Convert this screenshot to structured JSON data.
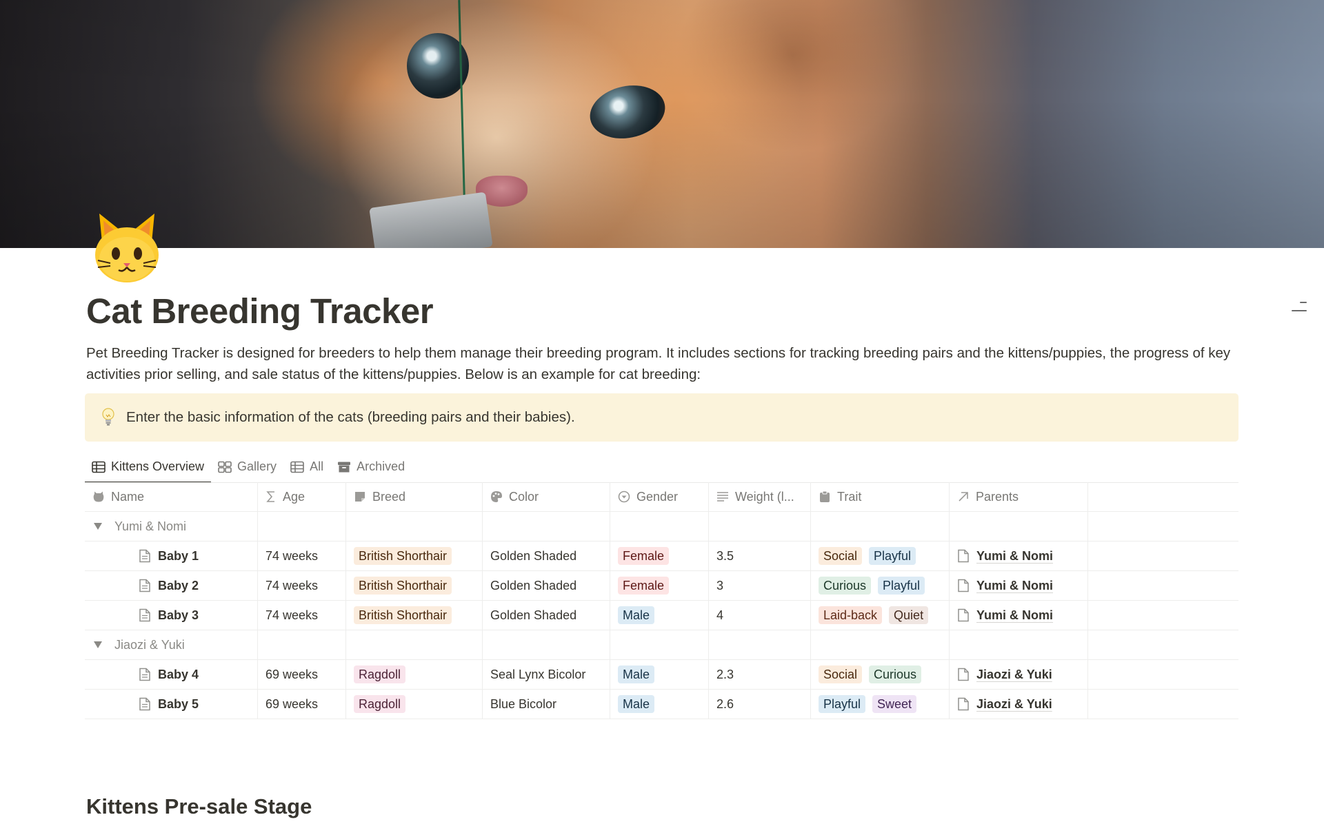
{
  "page": {
    "title": "Cat Breeding Tracker",
    "description": "Pet Breeding Tracker is designed for breeders to help them manage their breeding program. It includes sections for tracking breeding pairs and the kittens/puppies, the progress of key activities prior selling, and sale status of the kittens/puppies. Below is an example for cat breeding:",
    "icon": "cat-face-icon",
    "cover": "kitten-photo"
  },
  "callout": {
    "icon": "light-bulb-icon",
    "text": "Enter the basic information of the cats (breeding pairs and their babies)."
  },
  "tabs": [
    {
      "label": "Kittens Overview",
      "icon": "table-icon",
      "active": true
    },
    {
      "label": "Gallery",
      "icon": "gallery-icon",
      "active": false
    },
    {
      "label": "All",
      "icon": "table-icon",
      "active": false
    },
    {
      "label": "Archived",
      "icon": "archive-icon",
      "active": false
    }
  ],
  "table": {
    "columns": [
      {
        "label": "Name",
        "icon": "pet-icon"
      },
      {
        "label": "Age",
        "icon": "formula-icon"
      },
      {
        "label": "Breed",
        "icon": "select-icon"
      },
      {
        "label": "Color",
        "icon": "palette-icon"
      },
      {
        "label": "Gender",
        "icon": "status-icon"
      },
      {
        "label": "Weight (l...",
        "icon": "text-lines-icon"
      },
      {
        "label": "Trait",
        "icon": "clipboard-icon"
      },
      {
        "label": "Parents",
        "icon": "relation-arrow-icon"
      }
    ],
    "groups": [
      {
        "label": "Yumi & Nomi",
        "rows": [
          {
            "name": "Baby 1",
            "age": "74 weeks",
            "breed": "British Shorthair",
            "color": "Golden Shaded",
            "gender": "Female",
            "weight": "3.5",
            "traits": [
              "Social",
              "Playful"
            ],
            "parents": "Yumi & Nomi"
          },
          {
            "name": "Baby 2",
            "age": "74 weeks",
            "breed": "British Shorthair",
            "color": "Golden Shaded",
            "gender": "Female",
            "weight": "3",
            "traits": [
              "Curious",
              "Playful"
            ],
            "parents": "Yumi & Nomi"
          },
          {
            "name": "Baby 3",
            "age": "74 weeks",
            "breed": "British Shorthair",
            "color": "Golden Shaded",
            "gender": "Male",
            "weight": "4",
            "traits": [
              "Laid-back",
              "Quiet"
            ],
            "parents": "Yumi & Nomi"
          }
        ]
      },
      {
        "label": "Jiaozi & Yuki",
        "rows": [
          {
            "name": "Baby 4",
            "age": "69 weeks",
            "breed": "Ragdoll",
            "color": "Seal Lynx Bicolor",
            "gender": "Male",
            "weight": "2.3",
            "traits": [
              "Social",
              "Curious"
            ],
            "parents": "Jiaozi & Yuki"
          },
          {
            "name": "Baby 5",
            "age": "69 weeks",
            "breed": "Ragdoll",
            "color": "Blue Bicolor",
            "gender": "Male",
            "weight": "2.6",
            "traits": [
              "Playful",
              "Sweet"
            ],
            "parents": "Jiaozi & Yuki"
          }
        ]
      }
    ]
  },
  "tag_colors": {
    "British Shorthair": {
      "bg": "#fbecdd",
      "fg": "#49290e"
    },
    "Ragdoll": {
      "bg": "#f9e4ec",
      "fg": "#4c2337"
    },
    "Female": {
      "bg": "#fde4e4",
      "fg": "#5d1715"
    },
    "Male": {
      "bg": "#dcebf5",
      "fg": "#183347"
    },
    "Social": {
      "bg": "#fbecdd",
      "fg": "#49290e"
    },
    "Playful": {
      "bg": "#dcebf5",
      "fg": "#183347"
    },
    "Curious": {
      "bg": "#e0efe5",
      "fg": "#1c3829"
    },
    "Laid-back": {
      "bg": "#fbe4dc",
      "fg": "#5d2a17"
    },
    "Quiet": {
      "bg": "#f0e6e2",
      "fg": "#442a1e"
    },
    "Sweet": {
      "bg": "#efe4f5",
      "fg": "#412454"
    }
  },
  "section": {
    "title": "Kittens Pre-sale Stage"
  }
}
